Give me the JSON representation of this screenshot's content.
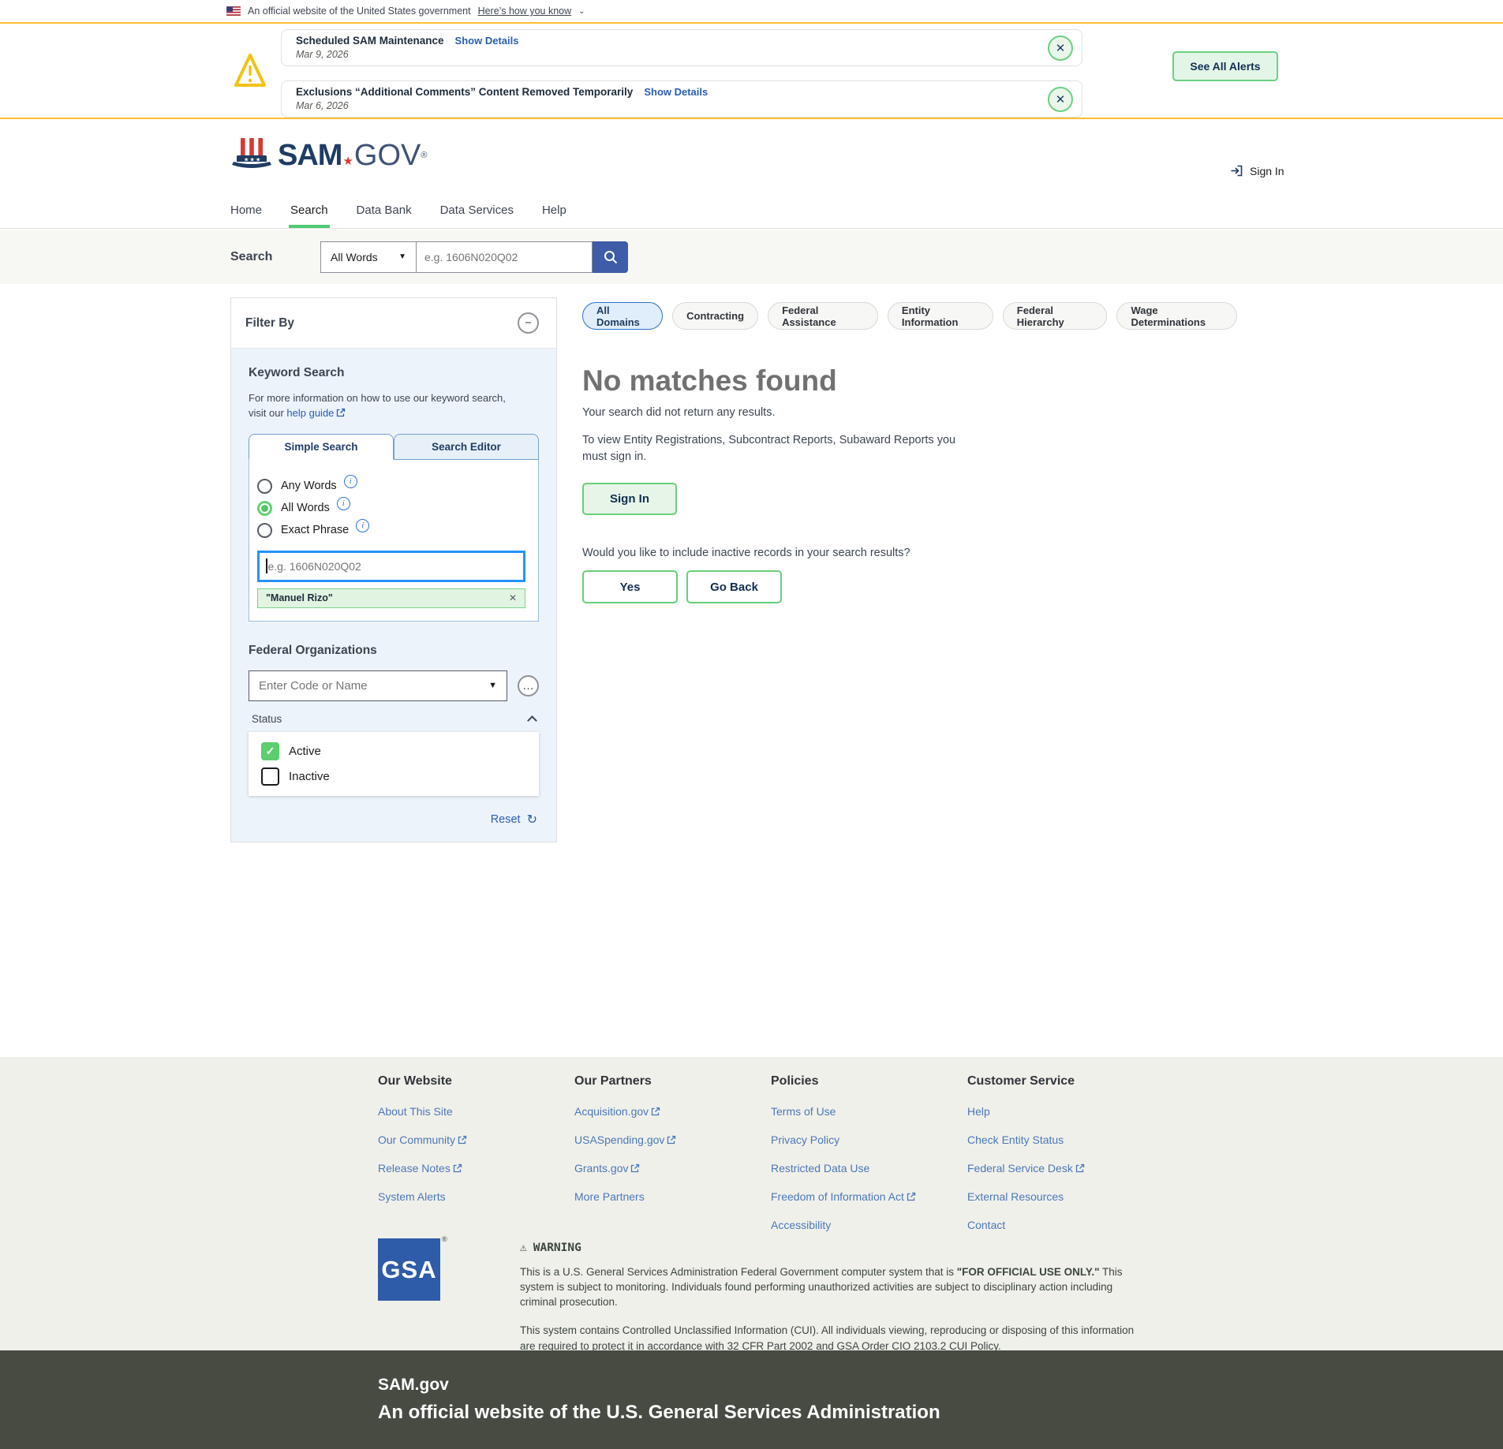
{
  "banner": {
    "text": "An official website of the United States government",
    "link": "Here’s how you know",
    "chevron": "⌄"
  },
  "alerts": {
    "items": [
      {
        "title": "Scheduled SAM Maintenance",
        "link": "Show Details",
        "date": "Mar 9, 2026"
      },
      {
        "title": "Exclusions “Additional Comments” Content Removed Temporarily",
        "link": "Show Details",
        "date": "Mar 6, 2026"
      }
    ],
    "see_all": "See All Alerts"
  },
  "header": {
    "logo_sam": "SAM",
    "logo_star": "★",
    "logo_gov": "GOV",
    "logo_reg": "®",
    "sign_in": "Sign In",
    "nav": [
      {
        "label": "Home"
      },
      {
        "label": "Search"
      },
      {
        "label": "Data Bank"
      },
      {
        "label": "Data Services"
      },
      {
        "label": "Help"
      }
    ]
  },
  "searchbar": {
    "label": "Search",
    "mode": "All Words",
    "caret": "▼",
    "placeholder": "e.g. 1606N020Q02"
  },
  "filter": {
    "title": "Filter By",
    "collapse_icon": "−",
    "keyword": {
      "heading": "Keyword Search",
      "info_text": "For more information on how to use our keyword search, visit our ",
      "help_link": "help guide",
      "tabs": [
        {
          "label": "Simple Search"
        },
        {
          "label": "Search Editor"
        }
      ],
      "radios": [
        {
          "label": "Any Words"
        },
        {
          "label": "All Words"
        },
        {
          "label": "Exact Phrase"
        }
      ],
      "info_icon": "i",
      "input_placeholder": "e.g. 1606N020Q02",
      "chip": "\"Manuel Rizo\"",
      "chip_close": "✕"
    },
    "org": {
      "heading": "Federal Organizations",
      "placeholder": "Enter Code or Name",
      "caret": "▼",
      "ellipsis": "…"
    },
    "status": {
      "label": "Status",
      "options": [
        {
          "label": "Active",
          "checked": "true"
        },
        {
          "label": "Inactive",
          "checked": "false"
        }
      ],
      "check_icon": "✓"
    },
    "reset": "Reset",
    "reset_icon": "↻"
  },
  "results": {
    "domains": [
      {
        "label": "All Domains"
      },
      {
        "label": "Contracting"
      },
      {
        "label": "Federal Assistance"
      },
      {
        "label": "Entity Information"
      },
      {
        "label": "Federal Hierarchy"
      },
      {
        "label": "Wage Determinations"
      }
    ],
    "title": "No matches found",
    "subtitle": "Your search did not return any results.",
    "signin_note": "To view Entity Registrations, Subcontract Reports, Subaward Reports you must sign in.",
    "signin_button": "Sign In",
    "inactive_question": "Would you like to include inactive records in your search results?",
    "yes_button": "Yes",
    "goback_button": "Go Back"
  },
  "footer": {
    "columns": [
      {
        "heading": "Our Website",
        "links": [
          {
            "label": "About This Site"
          },
          {
            "label": "Our Community"
          },
          {
            "label": "Release Notes"
          },
          {
            "label": "System Alerts"
          }
        ]
      },
      {
        "heading": "Our Partners",
        "links": [
          {
            "label": "Acquisition.gov"
          },
          {
            "label": "USASpending.gov"
          },
          {
            "label": "Grants.gov"
          },
          {
            "label": "More Partners"
          }
        ]
      },
      {
        "heading": "Policies",
        "links": [
          {
            "label": "Terms of Use"
          },
          {
            "label": "Privacy Policy"
          },
          {
            "label": "Restricted Data Use"
          },
          {
            "label": "Freedom of Information Act"
          },
          {
            "label": "Accessibility"
          }
        ]
      },
      {
        "heading": "Customer Service",
        "links": [
          {
            "label": "Help"
          },
          {
            "label": "Check Entity Status"
          },
          {
            "label": "Federal Service Desk"
          },
          {
            "label": "External Resources"
          },
          {
            "label": "Contact"
          }
        ]
      }
    ],
    "gsa": "GSA",
    "gsa_reg": "®",
    "warning_icon": "⚠",
    "warning_title": "WARNING",
    "p1a": "This is a U.S. General Services Administration Federal Government computer system that is ",
    "p1b": "\"FOR OFFICIAL USE ONLY.\"",
    "p1c": " This system is subject to monitoring. Individuals found performing unauthorized activities are subject to disciplinary action including criminal prosecution.",
    "p2": "This system contains Controlled Unclassified Information (CUI). All individuals viewing, reproducing or disposing of this information are required to protect it in accordance with 32 CFR Part 2002 and GSA Order CIO 2103.2 CUI Policy."
  },
  "bottom": {
    "title": "SAM.gov",
    "subtitle": "An official website of the U.S. General Services Administration"
  },
  "colors": {
    "accent_green": "#6BD081",
    "link_blue": "#2A5DB3",
    "navy": "#112E51",
    "search_blue": "#3E5CA8",
    "gold": "#FFBE2E",
    "footer_dark": "#474B42"
  }
}
